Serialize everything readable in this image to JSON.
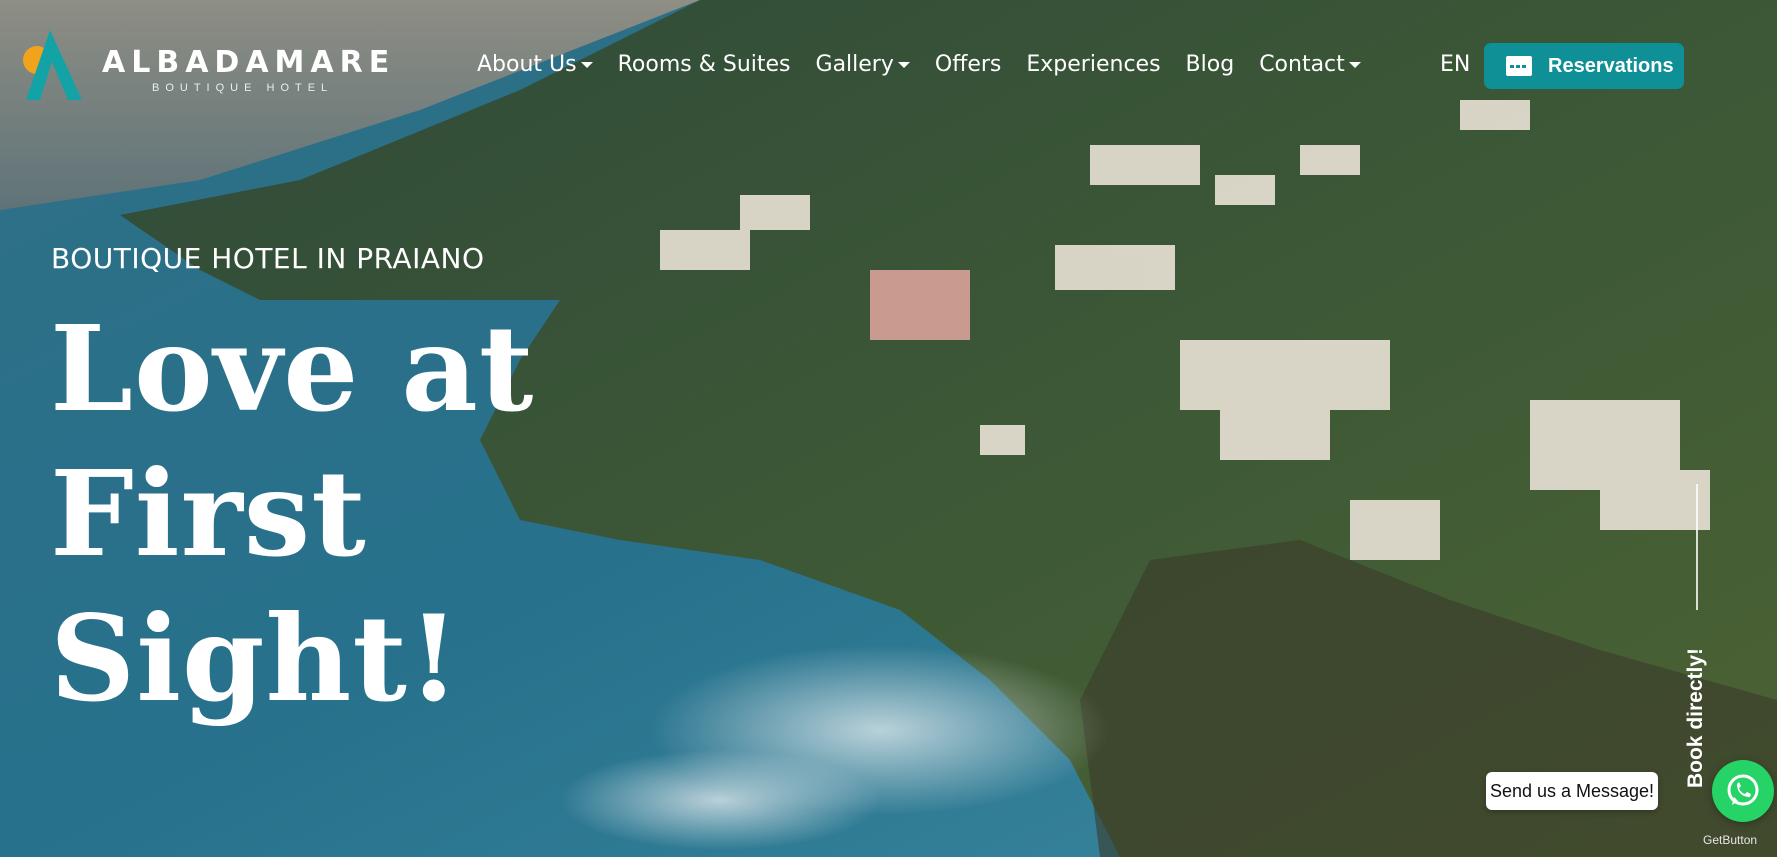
{
  "brand": {
    "name": "ALBADAMARE",
    "tagline": "BOUTIQUE HOTEL"
  },
  "nav": {
    "items": [
      {
        "label": "About Us",
        "has_dropdown": true
      },
      {
        "label": "Rooms & Suites",
        "has_dropdown": false
      },
      {
        "label": "Gallery",
        "has_dropdown": true
      },
      {
        "label": "Offers",
        "has_dropdown": false
      },
      {
        "label": "Experiences",
        "has_dropdown": false
      },
      {
        "label": "Blog",
        "has_dropdown": false
      },
      {
        "label": "Contact",
        "has_dropdown": true
      }
    ],
    "language": "EN",
    "reservations_label": "Reservations"
  },
  "hero": {
    "subtitle": "BOUTIQUE HOTEL IN PRAIANO",
    "headline_line1": "Love at First",
    "headline_line2": "Sight!"
  },
  "side": {
    "book_directly": "Book directly!"
  },
  "chat": {
    "message": "Send us a Message!",
    "powered": "GetButton"
  },
  "colors": {
    "accent": "#0f8f96",
    "whatsapp": "#25d366",
    "logo_orange": "#f2a31c",
    "logo_teal": "#13a3a6"
  },
  "icons": {
    "reservations": "credit-card-icon",
    "chat": "whatsapp-icon",
    "dropdown": "chevron-down-icon"
  }
}
